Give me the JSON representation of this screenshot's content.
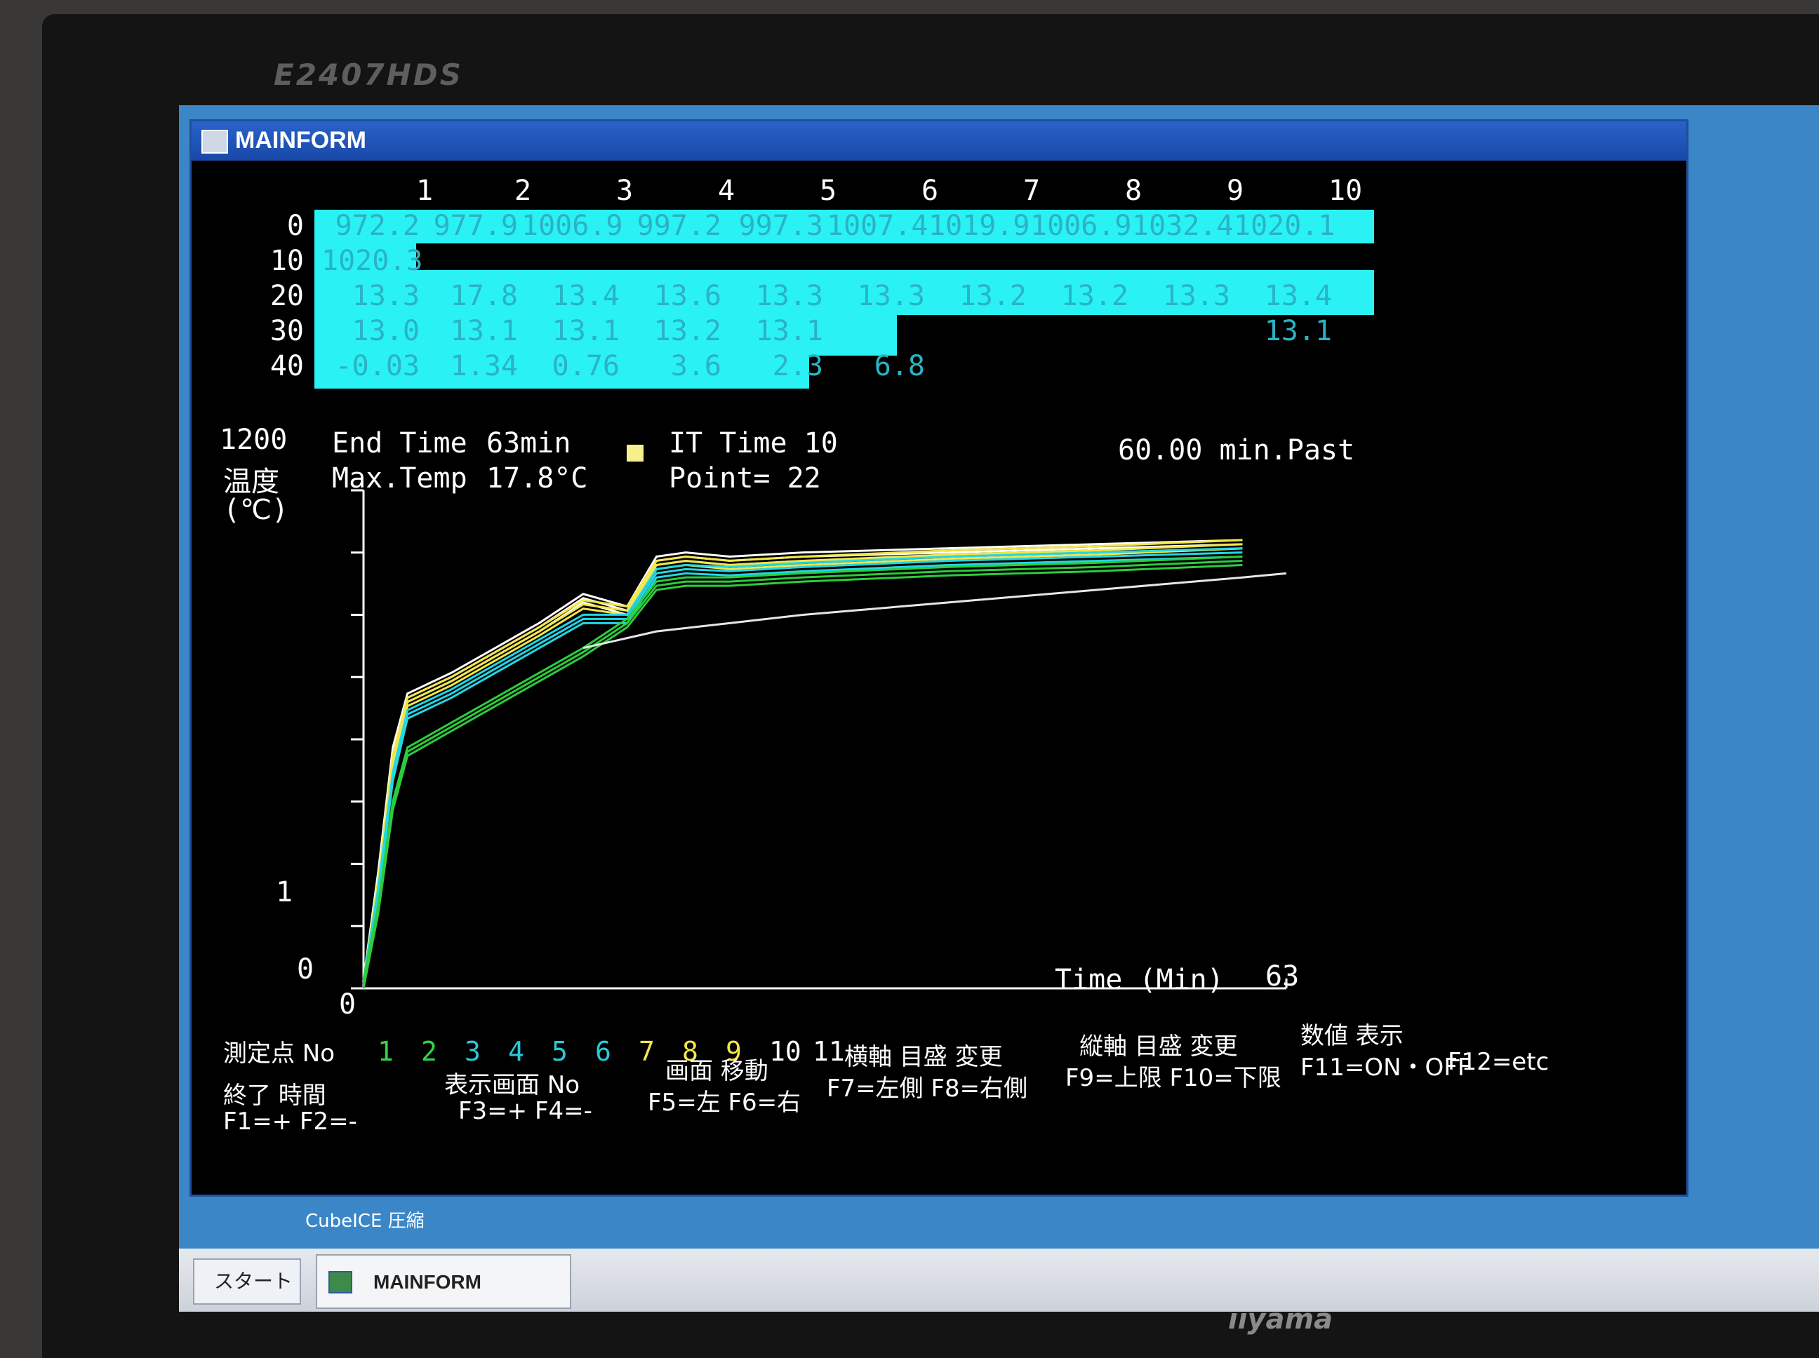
{
  "monitor": {
    "model": "E2407HDS",
    "brand": "iiyama"
  },
  "window": {
    "title": "MAINFORM"
  },
  "table": {
    "columns": [
      "1",
      "2",
      "3",
      "4",
      "5",
      "6",
      "7",
      "8",
      "9",
      "10"
    ],
    "row_labels": [
      "0",
      "10",
      "20",
      "30",
      "40"
    ],
    "rows": [
      [
        "972.2",
        "977.9",
        "1006.9",
        "997.2",
        "997.3",
        "1007.4",
        "1019.9",
        "1006.9",
        "1032.4",
        "1020.1"
      ],
      [
        "1020.3",
        "",
        "",
        "",
        "",
        "",
        "",
        "",
        "",
        ""
      ],
      [
        "13.3",
        "17.8",
        "13.4",
        "13.6",
        "13.3",
        "13.3",
        "13.2",
        "13.2",
        "13.3",
        "13.4"
      ],
      [
        "13.0",
        "13.1",
        "13.1",
        "13.2",
        "13.1",
        "",
        "",
        "",
        "",
        "13.1"
      ],
      [
        "-0.03",
        "1.34",
        "0.76",
        "3.6",
        "2.3",
        "6.8",
        "",
        "",
        "",
        ""
      ]
    ]
  },
  "info": {
    "end_time_label": "End Time",
    "end_time_value": "63min",
    "max_temp_label": "Max.Temp",
    "max_temp_value": "17.8°C",
    "it_time": "IT Time 10",
    "point": "Point= 22",
    "elapsed": "60.00 min.Past"
  },
  "chart_data": {
    "type": "line",
    "y_axis": {
      "top_label": "1200",
      "label_1": "温度",
      "label_2": "(℃)",
      "mid_label": "1",
      "zero_label": "0"
    },
    "x_axis": {
      "label": "Time (Min)",
      "min_label": "0",
      "max_label": "63",
      "range": [
        0,
        63
      ]
    },
    "ylim": [
      0,
      1200
    ],
    "series": [
      {
        "color": "#ffffff",
        "x": [
          0,
          1,
          2,
          3,
          6,
          9,
          12,
          15,
          18,
          20,
          22,
          25,
          30,
          40,
          50,
          60
        ],
        "y": [
          0,
          260,
          560,
          690,
          740,
          800,
          860,
          930,
          900,
          1020,
          1030,
          1020,
          1030,
          1040,
          1050,
          1060
        ]
      },
      {
        "color": "#f3e64a",
        "x": [
          0,
          1,
          2,
          3,
          6,
          9,
          12,
          15,
          18,
          20,
          22,
          25,
          30,
          40,
          50,
          60
        ],
        "y": [
          0,
          240,
          540,
          680,
          730,
          790,
          850,
          915,
          900,
          1010,
          1020,
          1010,
          1020,
          1035,
          1045,
          1060
        ]
      },
      {
        "color": "#22d7e6",
        "x": [
          0,
          1,
          2,
          3,
          6,
          9,
          12,
          15,
          18,
          20,
          22,
          25,
          30,
          40,
          50,
          60
        ],
        "y": [
          0,
          220,
          500,
          650,
          700,
          760,
          820,
          880,
          880,
          990,
          1000,
          995,
          1005,
          1020,
          1030,
          1040
        ]
      },
      {
        "color": "#2ccc3c",
        "x": [
          0,
          1,
          2,
          3,
          6,
          9,
          12,
          15,
          18,
          20,
          22,
          25,
          30,
          40,
          50,
          60
        ],
        "y": [
          0,
          180,
          430,
          560,
          620,
          680,
          740,
          800,
          870,
          960,
          970,
          970,
          980,
          995,
          1005,
          1020
        ]
      },
      {
        "color": "#e6e6e6",
        "x": [
          15,
          20,
          25,
          30,
          40,
          50,
          60,
          63
        ],
        "y": [
          820,
          860,
          880,
          900,
          930,
          960,
          990,
          1000
        ]
      }
    ]
  },
  "legend": {
    "label": "測定点 No",
    "items": [
      {
        "text": "1",
        "color": "#2fd84a"
      },
      {
        "text": "2",
        "color": "#2fd84a"
      },
      {
        "text": "3",
        "color": "#29c9d9"
      },
      {
        "text": "4",
        "color": "#29c9d9"
      },
      {
        "text": "5",
        "color": "#29c9d9"
      },
      {
        "text": "6",
        "color": "#29c9d9"
      },
      {
        "text": "7",
        "color": "#f3e64a"
      },
      {
        "text": "8",
        "color": "#f3e64a"
      },
      {
        "text": "9",
        "color": "#f3e64a"
      },
      {
        "text": "10",
        "color": "#ffffff"
      },
      {
        "text": "11",
        "color": "#ffffff"
      }
    ]
  },
  "function_keys": {
    "end_time_title": "終了 時間",
    "end_time_keys": "F1=+ F2=-",
    "screen_no_title": "表示画面 No",
    "screen_no_keys": "F3=+ F4=-",
    "move_title": "画面 移動",
    "move_keys": "F5=左 F6=右",
    "x_scale_title": "横軸 目盛 変更",
    "x_scale_keys": "F7=左側 F8=右側",
    "y_scale_title": "縦軸 目盛 変更",
    "y_scale_keys": "F9=上限 F10=下限",
    "values_title": "数値 表示",
    "values_keys": "F11=ON・OFF",
    "etc": "F12=etc"
  },
  "desktop": {
    "icon_label": "CubeICE 圧縮"
  },
  "taskbar": {
    "start": "スタート",
    "task": "MAINFORM"
  }
}
